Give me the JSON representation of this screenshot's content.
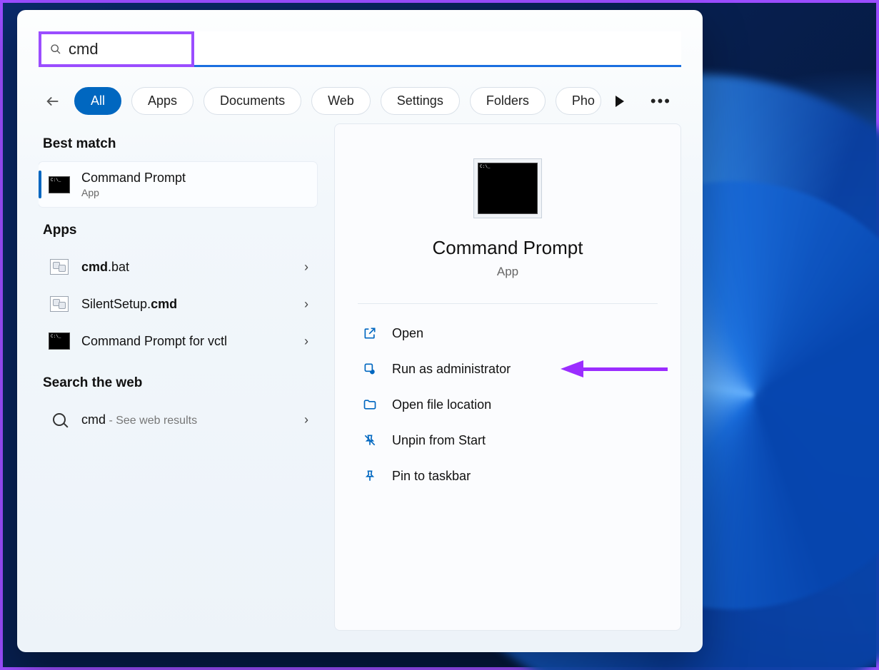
{
  "search": {
    "value": "cmd"
  },
  "filters": {
    "items": [
      {
        "label": "All",
        "active": true
      },
      {
        "label": "Apps"
      },
      {
        "label": "Documents"
      },
      {
        "label": "Web"
      },
      {
        "label": "Settings"
      },
      {
        "label": "Folders"
      },
      {
        "label": "Pho",
        "cut": true
      }
    ]
  },
  "results": {
    "best_match_header": "Best match",
    "best_match": {
      "title": "Command Prompt",
      "subtitle": "App"
    },
    "apps_header": "Apps",
    "apps": [
      {
        "title_prefix": "cmd",
        "title_suffix": ".bat",
        "icon": "bat"
      },
      {
        "title_prefix": "SilentSetup.",
        "title_suffix": "cmd",
        "icon": "bat"
      },
      {
        "title_prefix": "Command Prompt for vctl",
        "title_suffix": "",
        "icon": "cmd"
      }
    ],
    "web_header": "Search the web",
    "web": {
      "query": "cmd",
      "suffix": " - See web results"
    }
  },
  "preview": {
    "title": "Command Prompt",
    "subtitle": "App",
    "actions": [
      {
        "label": "Open",
        "icon": "open"
      },
      {
        "label": "Run as administrator",
        "icon": "shield",
        "annotated": true
      },
      {
        "label": "Open file location",
        "icon": "folder"
      },
      {
        "label": "Unpin from Start",
        "icon": "unpin"
      },
      {
        "label": "Pin to taskbar",
        "icon": "pin"
      }
    ]
  }
}
